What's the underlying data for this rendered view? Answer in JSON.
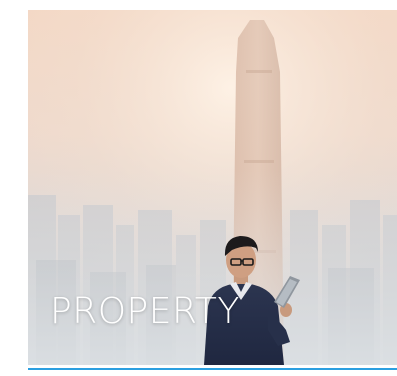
{
  "card": {
    "title": "PROPERTY"
  },
  "colors": {
    "accent_line": "#2b9fe0",
    "title_text": "#ffffff"
  }
}
